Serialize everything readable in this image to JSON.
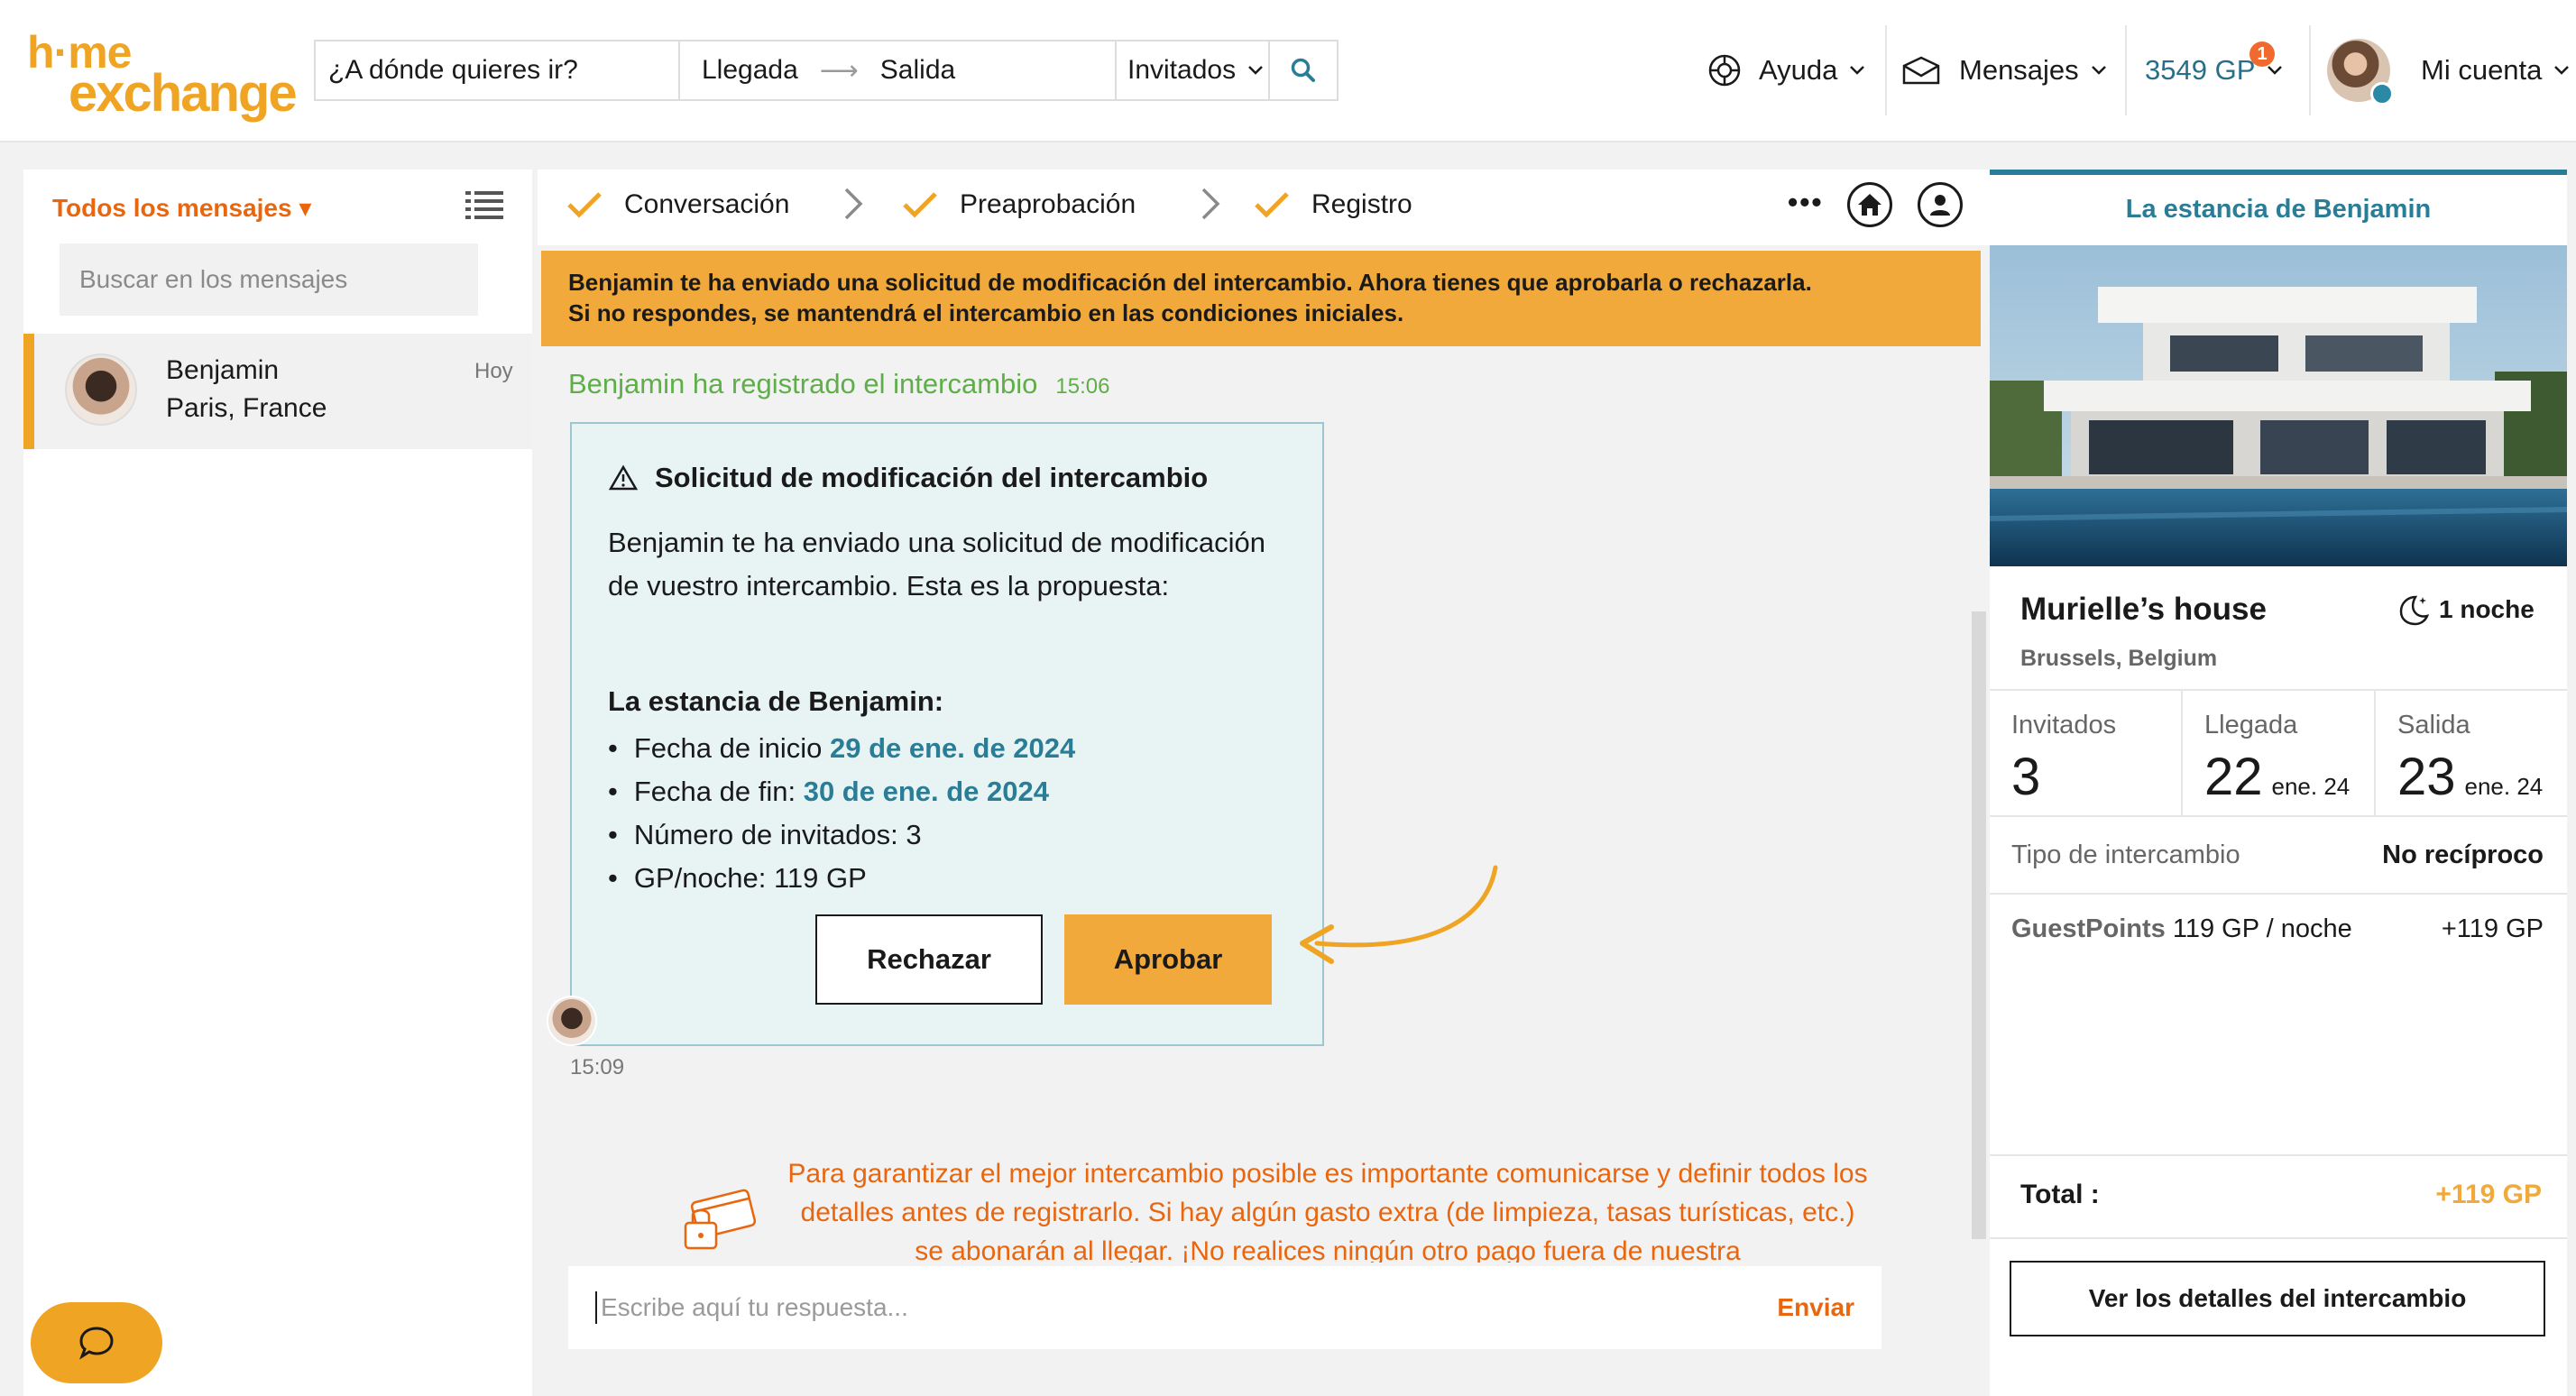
{
  "header": {
    "logo_top": "h·me",
    "logo_bottom": "exchange",
    "search_placeholder": "¿A dónde quieres ir?",
    "arrival": "Llegada",
    "departure": "Salida",
    "guests": "Invitados",
    "help": "Ayuda",
    "messages": "Mensajes",
    "gp": "3549 GP",
    "notification_count": "1",
    "account": "Mi cuenta"
  },
  "sidebar": {
    "title": "Todos los mensajes ▾",
    "search_placeholder": "Buscar en los mensajes",
    "conversations": [
      {
        "name": "Benjamin",
        "location": "Paris, France",
        "time": "Hoy"
      }
    ]
  },
  "steps": [
    {
      "label": "Conversación"
    },
    {
      "label": "Preaprobación"
    },
    {
      "label": "Registro"
    }
  ],
  "banner": {
    "line1": "Benjamin te ha enviado una solicitud de modificación del intercambio. Ahora tienes que aprobarla o rechazarla.",
    "line2": "Si no respondes, se mantendrá el intercambio en las condiciones iniciales."
  },
  "registered": {
    "text": "Benjamin ha registrado el intercambio",
    "time": "15:06"
  },
  "card": {
    "title": "Solicitud de modificación del intercambio",
    "paragraph": "Benjamin te ha enviado una solicitud de modificación de vuestro intercambio. Esta es la propuesta:",
    "subtitle": "La estancia de Benjamin:",
    "start_label": "Fecha de inicio ",
    "start_value": "29 de ene. de 2024",
    "end_label": "Fecha de fin: ",
    "end_value": "30 de ene. de 2024",
    "guests_line": "Número de invitados: 3",
    "gp_line": "GP/noche: 119 GP",
    "reject": "Rechazar",
    "approve": "Aprobar",
    "time": "15:09"
  },
  "tip": "Para garantizar el mejor intercambio posible es importante comunicarse y definir todos los detalles antes de registrarlo. Si hay algún gasto extra (de limpieza, tasas turísticas, etc.) se abonarán al llegar. ¡No realices ningún otro pago fuera de nuestra",
  "reply": {
    "placeholder": "Escribe aquí tu respuesta...",
    "send": "Enviar"
  },
  "right": {
    "title": "La estancia de Benjamin",
    "house_name": "Murielle’s house",
    "house_location": "Brussels, Belgium",
    "nights": "1 noche",
    "guests_label": "Invitados",
    "guests_value": "3",
    "arrival_label": "Llegada",
    "arrival_day": "22",
    "arrival_month": "ene. 24",
    "departure_label": "Salida",
    "departure_day": "23",
    "departure_month": "ene. 24",
    "exchange_type_label": "Tipo de intercambio",
    "exchange_type_value": "No recíproco",
    "guestpoints_label": "GuestPoints",
    "guestpoints_rate": "119 GP / noche",
    "guestpoints_value": "+119 GP",
    "total_label": "Total :",
    "total_value": "+119 GP",
    "details_button": "Ver los detalles del intercambio"
  }
}
